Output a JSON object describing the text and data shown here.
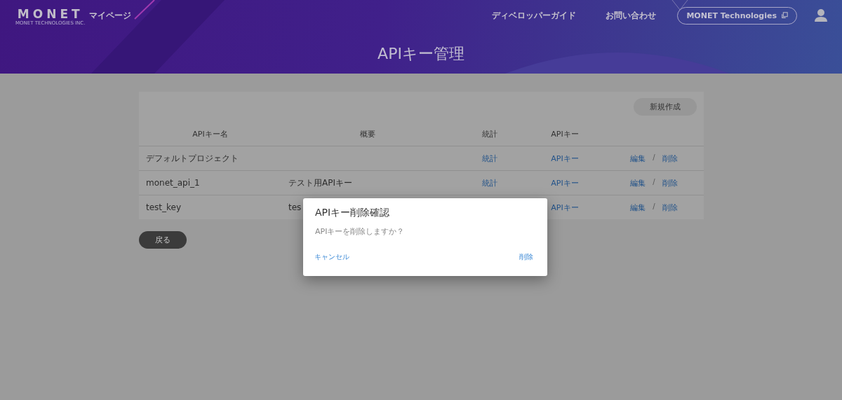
{
  "header": {
    "logo": "MONET",
    "logo_sub": "MONET TECHNOLOGIES INC.",
    "nav_left": "マイページ",
    "nav": [
      "ディベロッパーガイド",
      "お問い合わせ"
    ],
    "company_button": "MONET Technologies",
    "title": "APIキー管理"
  },
  "new_button": "新規作成",
  "table": {
    "columns": [
      "APIキー名",
      "概要",
      "統計",
      "APIキー"
    ],
    "rows": [
      {
        "name": "デフォルトプロジェクト",
        "summary": "",
        "stats": "統計",
        "key": "APIキー",
        "edit": "編集",
        "sep": "/",
        "delete": "削除"
      },
      {
        "name": "monet_api_1",
        "summary": "テスト用APIキー",
        "stats": "統計",
        "key": "APIキー",
        "edit": "編集",
        "sep": "/",
        "delete": "削除"
      },
      {
        "name": "test_key",
        "summary": "tes",
        "stats": "",
        "key": "APIキー",
        "edit": "編集",
        "sep": "/",
        "delete": "削除"
      }
    ]
  },
  "back_button": "戻る",
  "dialog": {
    "title": "APIキー削除確認",
    "message": "APIキーを削除しますか？",
    "cancel": "キャンセル",
    "confirm": "削除"
  }
}
